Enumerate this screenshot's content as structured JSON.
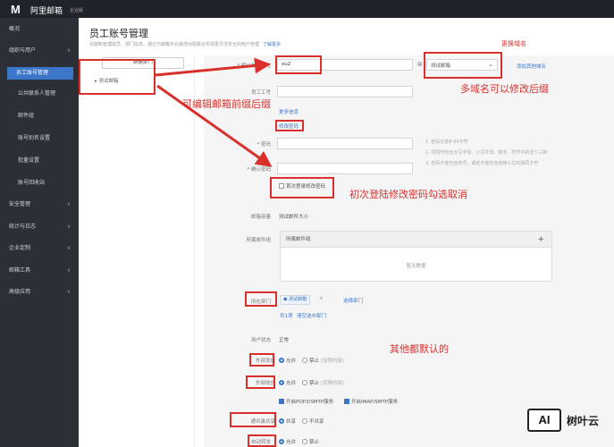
{
  "topbar": {
    "logo": "M",
    "brand": "阿里邮箱",
    "edition": "企业版"
  },
  "sidebar": {
    "items": [
      {
        "label": "概况"
      },
      {
        "label": "组织与用户"
      },
      {
        "label": "员工账号管理"
      },
      {
        "label": "公共联系人管理"
      },
      {
        "label": "邮件组"
      },
      {
        "label": "账号别名设置"
      },
      {
        "label": "批量设置"
      },
      {
        "label": "账号回收站"
      },
      {
        "label": "安全管理"
      },
      {
        "label": "统计与日志"
      },
      {
        "label": "企业定制"
      },
      {
        "label": "邮箱工具"
      },
      {
        "label": "高级应用"
      }
    ]
  },
  "page": {
    "title": "员工账号管理",
    "desc": "创建和管理成员、部门信息，通过与邮箱平台其他功能联合实现更灵活安全的用户管理",
    "more": "了解更多"
  },
  "dept": {
    "add_button": "新建部门",
    "root_node": "测试邮箱"
  },
  "form": {
    "account_label": "* 默认邮件地址",
    "account_value": "xu2",
    "at": "@",
    "domain_value": "测试邮箱",
    "domain_link": "添加其他域名",
    "empno_label": "员工工号",
    "more_info": "更多信息",
    "set_password": "修改密码",
    "password_label": "* 密码",
    "confirm_label": "* 确认密码",
    "hints": [
      "1. 密码长度8-64字符",
      "2. 须同时包含大写字母、小写字母、数字、符号中的至少三种",
      "3. 密码不能包含账号，或者不能包含连续三位的相同字符"
    ],
    "first_login_change": "首次登录修改密码",
    "mail_type_label": "邮箱容量",
    "mail_type_value": "测试邮件大小",
    "group_label": "所属邮件组",
    "group_head": "所属邮件组",
    "group_empty": "暂无数据",
    "dept_label": "所在部门",
    "dept_tag": "测试邮箱",
    "dept_select": "选择部门",
    "dept_count": "共1项",
    "dept_clear": "清空选中部门",
    "status_label": "用户状态",
    "status_value": "正常",
    "send_label": "外部发信",
    "recv_label": "外部收信",
    "allow": "允许",
    "deny": "禁止",
    "deny_hint_send": "(仅限内部)",
    "deny_hint_recv": "(仅限内部)",
    "pop_smtp": "开启POP3/SMTP服务",
    "imap_smtp": "开启IMAP/SMTP服务",
    "share_label": "通讯录共享",
    "share_yes": "共享",
    "share_no": "不共享",
    "autoreply_label": "自动转发",
    "autoreply_allow": "允许",
    "autoreply_deny": "禁止"
  },
  "annotations": {
    "change_domain": "更换域名",
    "domain_suffix": "多域名可以修改后缀",
    "prefix": "可编辑邮箱前缀后缀",
    "first_login": "初次登陆修改密码勾选取消",
    "defaults": "其他都默认的"
  },
  "watermark": {
    "ai": "AI",
    "text": "树叶云"
  },
  "colors": {
    "accent": "#3c76c8",
    "annotation": "#d9302c",
    "sidebar": "#2c3036"
  }
}
